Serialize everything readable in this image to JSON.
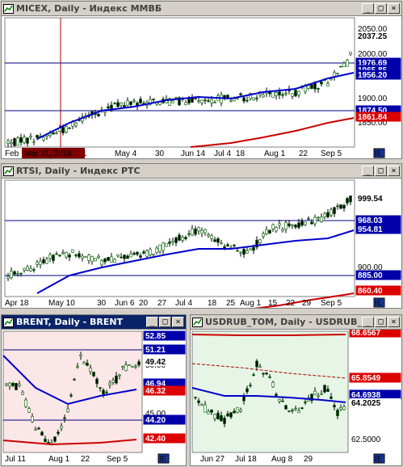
{
  "windows": [
    {
      "id": "micex",
      "title": "MICEX, Daily - Индекс ММВБ",
      "active": false,
      "plot_bg": "#ffffff",
      "price_axis": [
        "2050.00",
        "2000.00",
        "1950.00",
        "1900.00",
        "1850.00"
      ],
      "date_axis": [
        "Feb",
        "11",
        "May 4",
        "30",
        "Jun 14",
        "Jul 4",
        "18",
        "Aug 1",
        "22",
        "Sep 5"
      ],
      "highlighted_date": "Mar 31, 2016",
      "price_labels": [
        {
          "text": "2037.25",
          "bg": "#ffffff",
          "fg": "#000000"
        },
        {
          "text": "1976.69",
          "bg": "#0000aa",
          "fg": "#ffffff"
        },
        {
          "text": "1965.85",
          "bg": "#0000aa",
          "fg": "#ffffff"
        },
        {
          "text": "1956.20",
          "bg": "#0000aa",
          "fg": "#ffffff"
        },
        {
          "text": "1874.50",
          "bg": "#0000aa",
          "fg": "#ffffff"
        },
        {
          "text": "1861.84",
          "bg": "#dd0000",
          "fg": "#ffffff"
        }
      ]
    },
    {
      "id": "rtsi",
      "title": "RTSI, Daily - Индекс РТС",
      "active": false,
      "plot_bg": "#ffffff",
      "price_axis": [
        "900.00"
      ],
      "date_axis": [
        "Apr 18",
        "May 10",
        "30",
        "Jun 6",
        "20",
        "27",
        "Jul 4",
        "18",
        "25",
        "Aug 1",
        "15",
        "22",
        "29",
        "Sep 5"
      ],
      "price_labels": [
        {
          "text": "999.54",
          "bg": "#ffffff",
          "fg": "#000000"
        },
        {
          "text": "968.03",
          "bg": "#0000aa",
          "fg": "#ffffff"
        },
        {
          "text": "954.81",
          "bg": "#0000aa",
          "fg": "#ffffff"
        },
        {
          "text": "885.00",
          "bg": "#0000aa",
          "fg": "#ffffff"
        },
        {
          "text": "860.40",
          "bg": "#dd0000",
          "fg": "#ffffff"
        }
      ]
    },
    {
      "id": "brent",
      "title": "BRENT, Daily - BRENT",
      "active": true,
      "plot_bg": "#fbe7e7",
      "price_axis": [
        "50.00",
        "45.00"
      ],
      "date_axis": [
        "Jul 11",
        "Aug 1",
        "22",
        "Sep 5"
      ],
      "price_labels": [
        {
          "text": "52.85",
          "bg": "#0000aa",
          "fg": "#ffffff"
        },
        {
          "text": "51.21",
          "bg": "#0000aa",
          "fg": "#ffffff"
        },
        {
          "text": "49.42",
          "bg": "#ffffff",
          "fg": "#000000"
        },
        {
          "text": "46.94",
          "bg": "#0000aa",
          "fg": "#ffffff"
        },
        {
          "text": "46.32",
          "bg": "#dd0000",
          "fg": "#ffffff"
        },
        {
          "text": "44.20",
          "bg": "#0000aa",
          "fg": "#ffffff"
        },
        {
          "text": "42.40",
          "bg": "#dd0000",
          "fg": "#ffffff"
        }
      ]
    },
    {
      "id": "usdrub",
      "title": "USDRUB_TOM, Daily - USDRUB_",
      "active": false,
      "plot_bg": "#e6f5e6",
      "price_axis": [
        "65.0000",
        "62.5000"
      ],
      "date_axis": [
        "Jun 27",
        "Jul 18",
        "Aug 8",
        "29"
      ],
      "price_labels": [
        {
          "text": "68.6567",
          "bg": "#dd0000",
          "fg": "#ffffff"
        },
        {
          "text": "65.8549",
          "bg": "#dd0000",
          "fg": "#ffffff"
        },
        {
          "text": "64.6938",
          "bg": "#0000aa",
          "fg": "#ffffff"
        },
        {
          "text": "64.2025",
          "bg": "#ffffff",
          "fg": "#000000"
        }
      ]
    }
  ],
  "icons": {
    "window": "chart-window-icon",
    "minimize": "minimize-icon",
    "maximize": "maximize-icon",
    "close": "close-icon",
    "navigator": "navigator-icon"
  }
}
